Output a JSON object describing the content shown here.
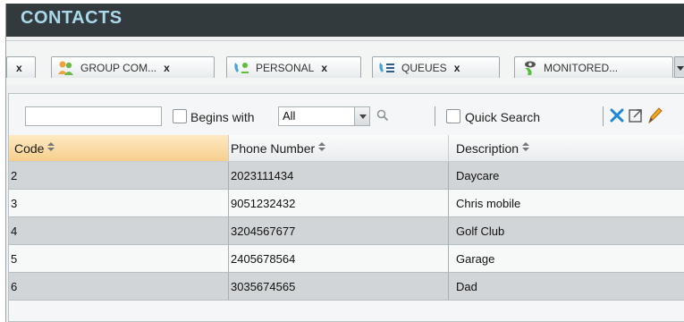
{
  "window": {
    "title": "CONTACTS"
  },
  "tabs": [
    {
      "label": "",
      "close": "x"
    },
    {
      "label": "GROUP COM...",
      "close": "x",
      "icon": "group-contacts-icon"
    },
    {
      "label": "PERSONAL",
      "close": "x",
      "icon": "personal-contacts-icon"
    },
    {
      "label": "QUEUES",
      "close": "x",
      "icon": "queues-icon"
    },
    {
      "label": "MONITORED...",
      "close": "",
      "icon": "monitored-icon"
    }
  ],
  "toolbar": {
    "search_value": "",
    "begins_with_label": "Begins with",
    "filter_selected": "All",
    "quick_search_label": "Quick Search"
  },
  "table": {
    "columns": [
      "Code",
      "Phone Number",
      "Description"
    ],
    "rows": [
      [
        "2",
        "2023111434",
        "Daycare"
      ],
      [
        "3",
        "9051232432",
        "Chris mobile"
      ],
      [
        "4",
        "3204567677",
        "Golf Club"
      ],
      [
        "5",
        "2405678564",
        "Garage"
      ],
      [
        "6",
        "3035674565",
        "Dad"
      ]
    ]
  },
  "colors": {
    "titlebar": "#333a3d",
    "title_text": "#a9d9ea",
    "active_header": "#f7cf8c",
    "row_dark": "#d1d5d7",
    "row_light": "#f7f8f8"
  }
}
